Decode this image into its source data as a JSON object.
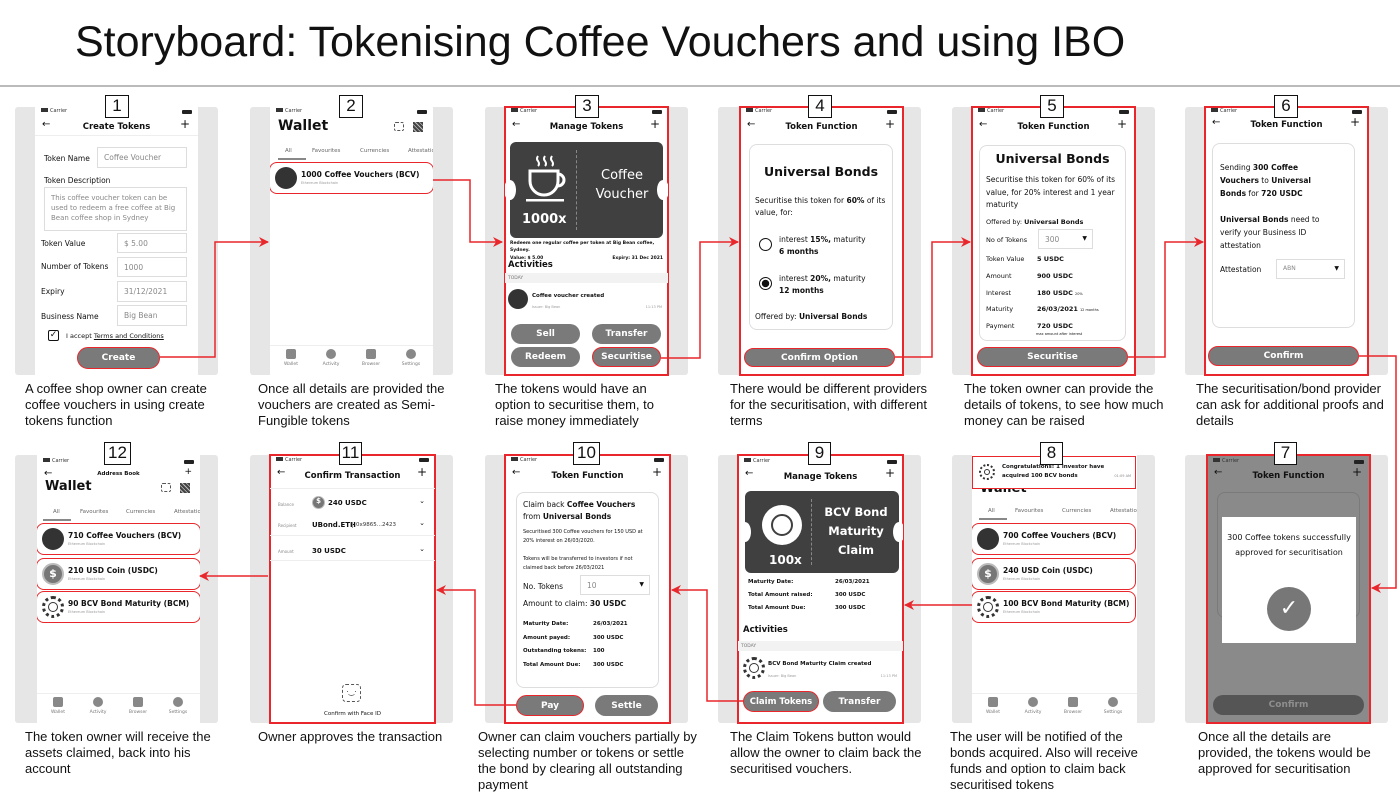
{
  "title": "Storyboard: Tokenising Coffee Vouchers and using IBO",
  "colors": {
    "accent_red": "#e8262b",
    "button_gray": "#7a7a7a",
    "card_dark": "#404040",
    "overlay_gray": "#8a8a8a"
  },
  "common": {
    "carrier": "Carrier",
    "back": "←",
    "plus": "+",
    "chain": "Ethereum Blockchain",
    "tabs": [
      "All",
      "Favourites",
      "Currencies",
      "Attestatio"
    ],
    "nav": [
      "Wallet",
      "Activity",
      "Browser",
      "Settings"
    ],
    "wallet": "Wallet",
    "today": "TODAY",
    "issuer": "Issuer: Big Bean",
    "time": "11:13 PM",
    "activities": "Activities"
  },
  "icons": [
    "back-arrow-icon",
    "plus-icon",
    "qr-scan-icon",
    "qr-code-icon",
    "coffee-cup-icon",
    "usdc-coin-icon",
    "bond-seal-icon",
    "face-id-icon",
    "check-icon",
    "chevron-down-icon",
    "radio-icon",
    "checkbox-icon"
  ],
  "s1": {
    "step": "1",
    "caption": "A coffee shop owner can create coffee vouchers in using create tokens function",
    "header": "Create Tokens",
    "name_label": "Token Name",
    "name": "Coffee Voucher",
    "desc_label": "Token Description",
    "desc": "This coffee voucher token can be used to redeem a free coffee at Big Bean coffee shop in Sydney",
    "value_label": "Token Value",
    "value": "$ 5.00",
    "count_label": "Number of Tokens",
    "count": "1000",
    "expiry_label": "Expiry",
    "expiry": "31/12/2021",
    "business_label": "Business Name",
    "business": "Big Bean",
    "accept": "I accept",
    "terms": "Terms and Conditions",
    "terms_checked": true,
    "create": "Create"
  },
  "s2": {
    "step": "2",
    "caption": "Once all details are provided the vouchers are created as Semi-Fungible tokens",
    "item": "1000 Coffee Vouchers (BCV)"
  },
  "s3": {
    "step": "3",
    "caption": "The tokens would have an option to securitise them, to raise money immediately",
    "header": "Manage Tokens",
    "count": "1000x",
    "voucher": "Coffee Voucher",
    "desc": "Redeem one regular coffee per token at Big Bean coffee, Sydney.",
    "value": "Value: $ 5.00",
    "expiry": "Expiry: 31 Dec 2021",
    "activity": "Coffee voucher created",
    "buttons": [
      "Sell",
      "Transfer",
      "Redeem",
      "Securitise"
    ]
  },
  "s4": {
    "step": "4",
    "caption": "There would be different providers for the securitisation, with different terms",
    "header": "Token Function",
    "title": "Universal Bonds",
    "p1": "Securitise this token for ",
    "p1b": "60%",
    "p2": " of its value, for:",
    "opt1a": "interest ",
    "opt1b": "15%,",
    "opt1c": " maturity",
    "opt1d": "6 months",
    "opt2a": "interest ",
    "opt2b": "20%,",
    "opt2c": " maturity",
    "opt2d": "12 months",
    "selected_option": 2,
    "offered": "Offered by: ",
    "offered_b": "Universal Bonds",
    "button": "Confirm Option"
  },
  "s5": {
    "step": "5",
    "caption": "The token owner can provide the details of tokens, to see how much money can be raised",
    "header": "Token Function",
    "title": "Universal Bonds",
    "p": "Securitise this token for 60% of its value, for 20% interest and 1 year maturity",
    "offered": "Offered by: ",
    "offered_b": "Universal Bonds",
    "count_label": "No of Tokens",
    "count": "300",
    "rows": [
      {
        "label": "Token Value",
        "value": "5 USDC",
        "note": ""
      },
      {
        "label": "Amount",
        "value": "900 USDC",
        "note": ""
      },
      {
        "label": "Interest",
        "value": "180 USDC",
        "note": "20%"
      },
      {
        "label": "Maturity",
        "value": "26/03/2021",
        "note": "12 months"
      },
      {
        "label": "Payment",
        "value": "720 USDC",
        "note": ""
      }
    ],
    "payment_note": "max amount after interest",
    "button": "Securitise"
  },
  "s6": {
    "step": "6",
    "caption": "The securitisation/bond provider can ask for additional proofs and details",
    "header": "Token Function",
    "a1": "Sending ",
    "a2": "300 Coffee Vouchers",
    "a3": "  to ",
    "a4": "Universal Bonds",
    "a5": " for ",
    "a6": "720 USDC",
    "b1": "Universal Bonds",
    "b2": " need to verify your Business ID attestation",
    "att_label": "Attestation",
    "att": "ABN",
    "button": "Confirm"
  },
  "s7": {
    "step": "7",
    "caption": "Once all the details are provided, the tokens would be approved for securitisation",
    "header": "Token Function",
    "modal": "300 Coffee tokens successfully approved for securitisation",
    "button": "Confirm"
  },
  "s8": {
    "step": "8",
    "caption": "The user will be notified of the bonds acquired. Also will receive funds and option to claim back securitised tokens",
    "notif": "Congratulations! 1 investor have acquired 100 BCV bonds",
    "notif_time": "01:09 AM",
    "items": [
      "700 Coffee Vouchers (BCV)",
      "240 USD Coin (USDC)",
      "100 BCV Bond Maturity (BCM)"
    ]
  },
  "s9": {
    "step": "9",
    "caption": "The Claim Tokens button would allow the owner to claim back the securitised vouchers.",
    "header": "Manage Tokens",
    "count": "100x",
    "title": "BCV Bond Maturity Claim",
    "rows": [
      {
        "label": "Maturity Date:",
        "value": "26/03/2021"
      },
      {
        "label": "Total Amount raised:",
        "value": "300 USDC"
      },
      {
        "label": "Total Amount Due:",
        "value": "300 USDC"
      }
    ],
    "activity": "BCV Bond Maturity Claim created",
    "buttons": [
      "Claim Tokens",
      "Transfer"
    ]
  },
  "s10": {
    "step": "10",
    "caption": "Owner can claim vouchers partially by selecting number or tokens or settle the bond by clearing all outstanding payment",
    "header": "Token Function",
    "c1": "Claim back ",
    "c1b": "Coffee Vouchers",
    "c2": "from ",
    "c2b": "Universal Bonds",
    "p1": "Securitised 300 Coffee vouchers for 150 USD at  20% interest on 26/03/2020.",
    "p2": "Tokens will be transferred to investors if not claimed back before 26/03/2021",
    "count_label": "No. Tokens",
    "count": "10",
    "claim": "Amount to claim: ",
    "claim_b": "30 USDC",
    "rows": [
      {
        "label": "Maturity Date:",
        "value": "26/03/2021"
      },
      {
        "label": "Amount payed:",
        "value": "300 USDC"
      },
      {
        "label": "Outstanding tokens:",
        "value": "100"
      },
      {
        "label": "Total Amount Due:",
        "value": "300 USDC"
      }
    ],
    "buttons": [
      "Pay",
      "Settle"
    ]
  },
  "s11": {
    "step": "11",
    "caption": "Owner approves the transaction",
    "header": "Confirm Transaction",
    "balance_label": "Balance",
    "balance": "240 USDC",
    "recipient_label": "Recipient",
    "recipient": "UBond.ETH",
    "address": "0x9865...2423",
    "amount_label": "Amount",
    "amount": "30 USDC",
    "faceid": "Confirm with Face ID"
  },
  "s12": {
    "step": "12",
    "caption": "The token owner will receive the assets claimed, back into his account",
    "header": "Address Book",
    "items": [
      "710 Coffee Vouchers (BCV)",
      "210 USD Coin (USDC)",
      "90 BCV Bond Maturity (BCM)"
    ]
  }
}
